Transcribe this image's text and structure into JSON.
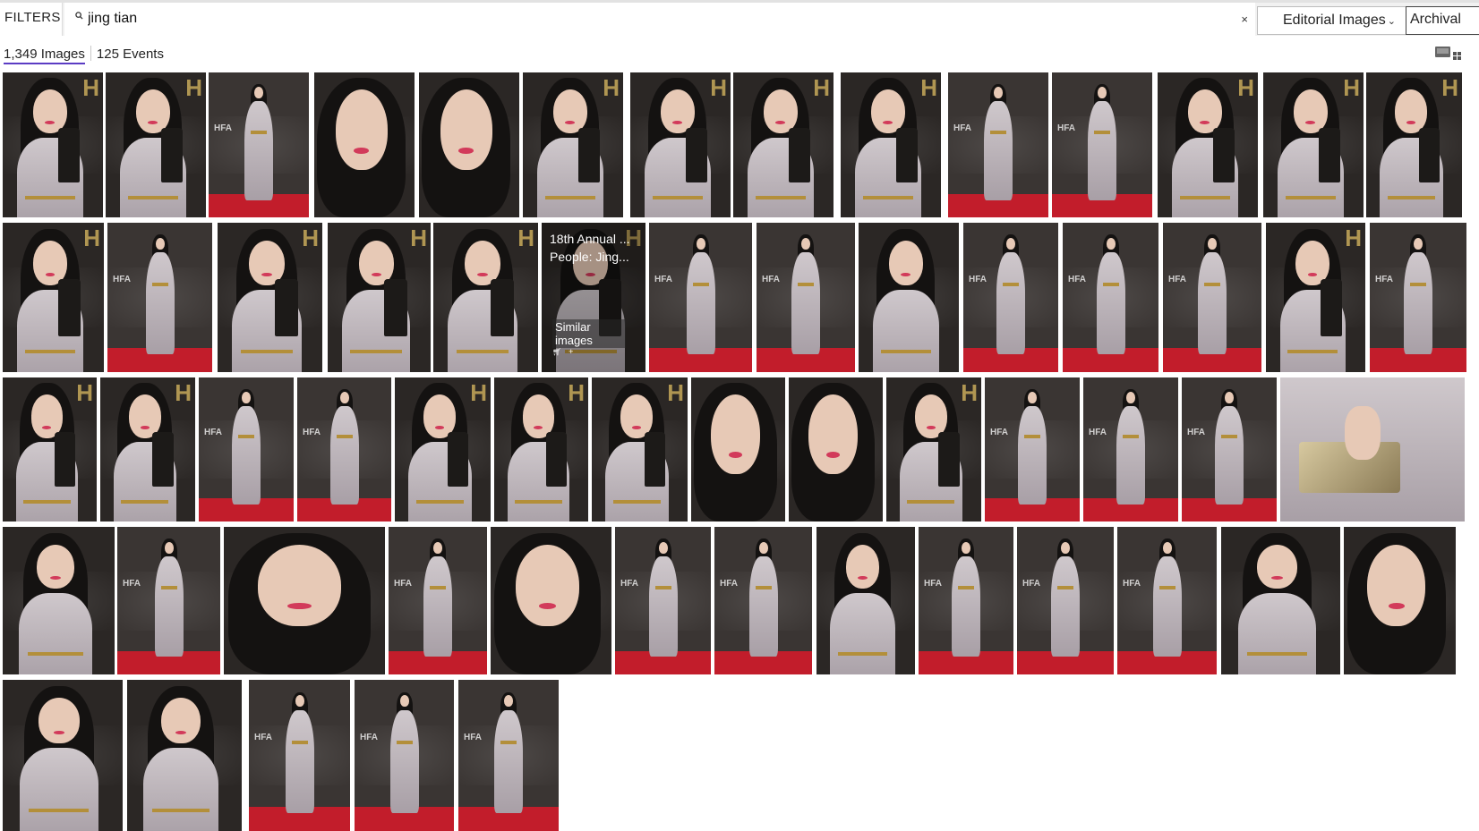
{
  "topbar": {
    "filters_label": "FILTERS",
    "search_value": "jing tian",
    "search_icon": "search-icon",
    "clear_glyph": "×",
    "asset_type_selected": "Editorial Images",
    "archival_label": "Archival"
  },
  "results": {
    "images_count_label": "1,349 Images",
    "events_count_label": "125 Events",
    "view_toggle_icon": "grid-view-icon"
  },
  "hover_overlay": {
    "caption": "18th Annual ... People: Jing...",
    "similar_label": "Similar images",
    "icons": [
      "cart-icon",
      "plus-icon"
    ]
  },
  "colors": {
    "accent_underline": "#5b3cc4",
    "backdrop_dark": "#2a2624",
    "red_carpet": "#c21d2b"
  },
  "thumbnail_kinds": {
    "award_closeup": "award-closeup",
    "full_length": "full-length",
    "headshot": "headshot",
    "half_length": "half-length",
    "clutch_detail": "clutch-detail"
  }
}
